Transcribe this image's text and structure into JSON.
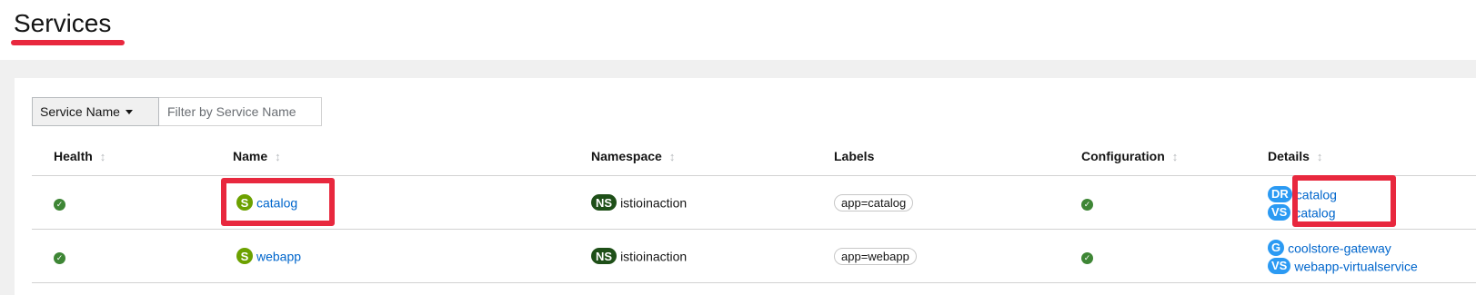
{
  "page": {
    "title": "Services"
  },
  "colors": {
    "accent_highlight": "#e8283e",
    "link": "#06c",
    "healthy": "#3e8635",
    "service_badge": "#6ca100",
    "namespace_badge": "#1e4f18",
    "istio_badge": "#2b9af3"
  },
  "filter": {
    "type_label": "Service Name",
    "placeholder": "Filter by Service Name"
  },
  "table": {
    "columns": {
      "health": "Health",
      "name": "Name",
      "namespace": "Namespace",
      "labels": "Labels",
      "configuration": "Configuration",
      "details": "Details"
    },
    "rows": [
      {
        "health": "healthy",
        "badge": "S",
        "name": "catalog",
        "ns_badge": "NS",
        "namespace": "istioinaction",
        "label": "app=catalog",
        "config": "valid",
        "details": [
          {
            "badge": "DR",
            "text": "catalog"
          },
          {
            "badge": "VS",
            "text": "catalog"
          }
        ]
      },
      {
        "health": "healthy",
        "badge": "S",
        "name": "webapp",
        "ns_badge": "NS",
        "namespace": "istioinaction",
        "label": "app=webapp",
        "config": "valid",
        "details": [
          {
            "badge": "G",
            "text": "coolstore-gateway"
          },
          {
            "badge": "VS",
            "text": "webapp-virtualservice"
          }
        ]
      }
    ]
  }
}
